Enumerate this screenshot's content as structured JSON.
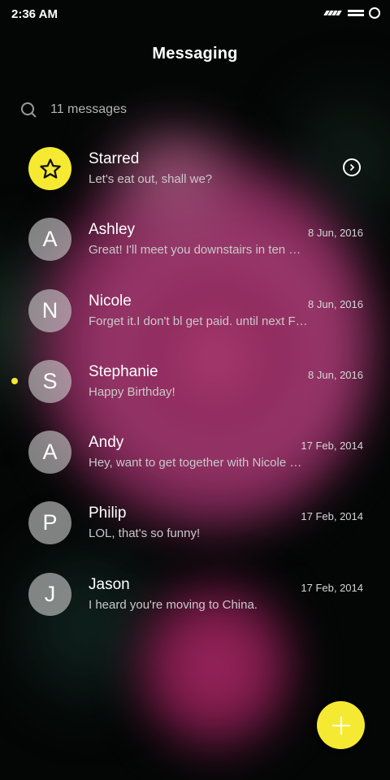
{
  "status_bar": {
    "time": "2:36 AM"
  },
  "header": {
    "title": "Messaging"
  },
  "search": {
    "count_label": "11 messages"
  },
  "conversations": [
    {
      "name": "Starred",
      "preview": "Let's eat out, shall we?",
      "date": "",
      "avatar": "star-icon",
      "unread": false
    },
    {
      "name": "Ashley",
      "preview": "Great! I'll meet you downstairs in ten …",
      "date": "8 Jun, 2016",
      "avatar": "A",
      "unread": false
    },
    {
      "name": "Nicole",
      "preview": "Forget it.I don't bl get paid. until next F…",
      "date": "8 Jun, 2016",
      "avatar": "N",
      "unread": false
    },
    {
      "name": "Stephanie",
      "preview": "Happy Birthday!",
      "date": "8 Jun, 2016",
      "avatar": "S",
      "unread": true
    },
    {
      "name": "Andy",
      "preview": "Hey, want to get together with Nicole …",
      "date": "17 Feb, 2014",
      "avatar": "A",
      "unread": false
    },
    {
      "name": "Philip",
      "preview": "LOL, that's so funny!",
      "date": "17 Feb, 2014",
      "avatar": "P",
      "unread": false
    },
    {
      "name": "Jason",
      "preview": "I heard you're moving to China.",
      "date": "17 Feb, 2014",
      "avatar": "J",
      "unread": false
    }
  ],
  "fab": {
    "icon": "plus-icon"
  },
  "colors": {
    "accent": "#f5ea31",
    "unread_dot": "#f4e932",
    "avatar_bg": "#cdcdcd"
  }
}
